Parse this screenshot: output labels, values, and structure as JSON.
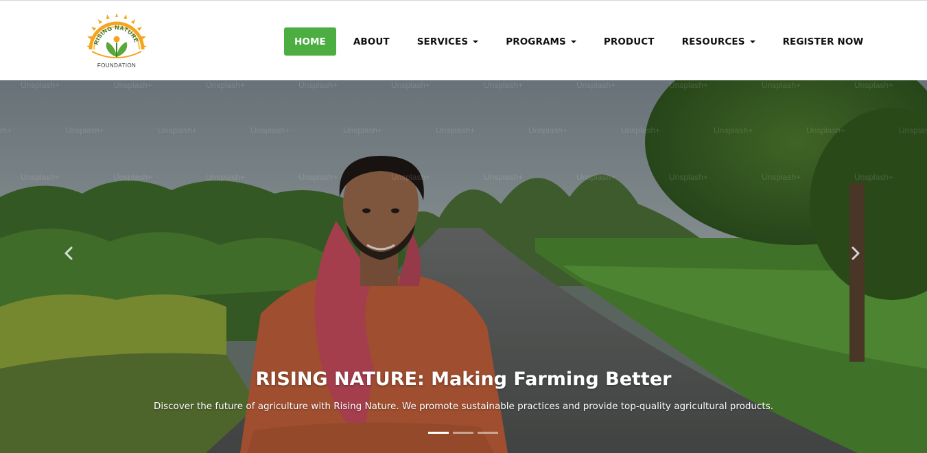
{
  "brand": {
    "arc_text": "RISING NATURE",
    "subtitle": "FOUNDATION",
    "colors": {
      "sun": "#f3a51d",
      "leaf": "#5aa83a",
      "arc_text": "#2f6f3a"
    }
  },
  "nav": {
    "items": [
      {
        "label": "HOME",
        "active": true,
        "dropdown": false
      },
      {
        "label": "ABOUT",
        "active": false,
        "dropdown": false
      },
      {
        "label": "SERVICES",
        "active": false,
        "dropdown": true
      },
      {
        "label": "PROGRAMS",
        "active": false,
        "dropdown": true
      },
      {
        "label": "PRODUCT",
        "active": false,
        "dropdown": false
      },
      {
        "label": "RESOURCES",
        "active": false,
        "dropdown": true
      },
      {
        "label": "REGISTER NOW",
        "active": false,
        "dropdown": false
      }
    ],
    "active_color": "#4cae41"
  },
  "hero": {
    "title": "RISING NATURE: Making Farming Better",
    "description": "Discover the future of agriculture with Rising Nature. We promote sustainable practices and provide top-quality agricultural products.",
    "watermark_text": "Unsplash+",
    "prev_icon": "chevron-left-icon",
    "next_icon": "chevron-right-icon",
    "slides": {
      "count": 3,
      "active": 1
    }
  }
}
